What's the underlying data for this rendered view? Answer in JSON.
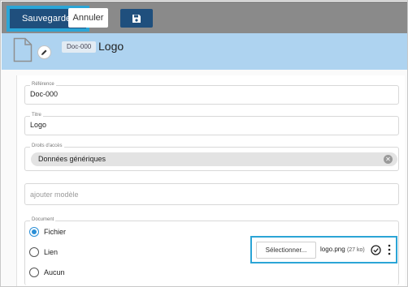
{
  "toolbar": {
    "save_label": "Sauvegarder",
    "cancel_label": "Annuler"
  },
  "header": {
    "doc_code": "Doc-000",
    "title": "Logo"
  },
  "form": {
    "reference": {
      "label": "Référence",
      "value": "Doc-000"
    },
    "titre": {
      "label": "Titre",
      "value": "Logo"
    },
    "droits": {
      "label": "Droits d'accès",
      "chip": "Données génériques"
    },
    "modele": {
      "placeholder": "ajouter modèle"
    },
    "document": {
      "label": "Document",
      "options": [
        "Fichier",
        "Lien",
        "Aucun"
      ],
      "selected": "Fichier"
    },
    "upload": {
      "select_label": "Sélectionner...",
      "file_name": "logo.png",
      "file_size": "(27 ko)"
    }
  },
  "colors": {
    "accent": "#1f4f7d",
    "highlight": "#2ba5d6",
    "header_band": "#aed3f0",
    "radio": "#2b8fd6"
  }
}
